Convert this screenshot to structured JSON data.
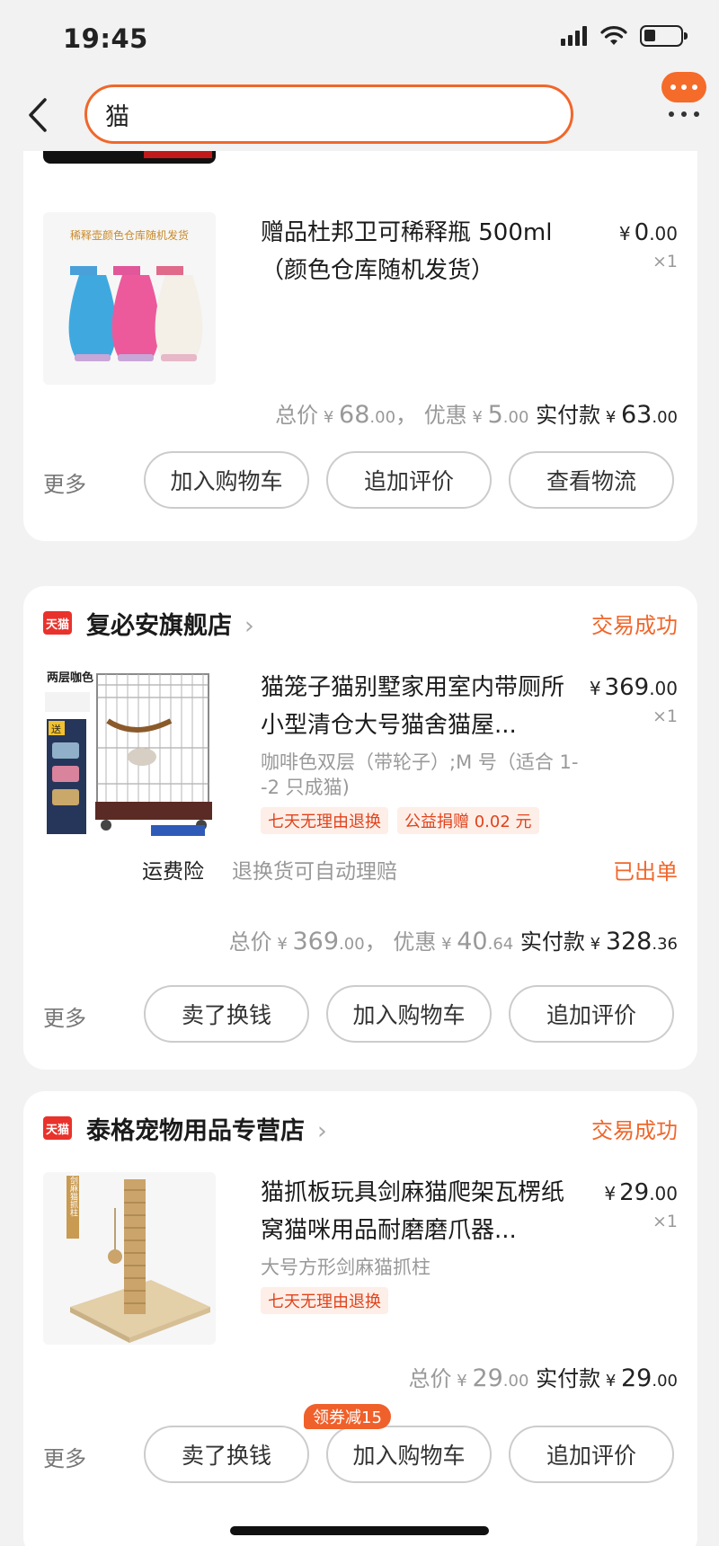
{
  "status_bar": {
    "time": "19:45"
  },
  "search": {
    "query": "猫"
  },
  "order1": {
    "product": {
      "title": "赠品杜邦卫可稀释瓶 500ml（颜色仓库随机发货）",
      "image_text": "稀释壶颜色仓库随机发货",
      "price_cur": "¥",
      "price_int": "0",
      "price_dec": ".00",
      "qty": "×1"
    },
    "totals": {
      "total_label": "总价",
      "total_int": "68",
      "total_dec": ".00",
      "sep": "，",
      "discount_label": "优惠",
      "discount_int": "5",
      "discount_dec": ".00",
      "pay_label": "实付款",
      "pay_int": "63",
      "pay_dec": ".00",
      "cur": "¥"
    },
    "actions": {
      "more": "更多",
      "btn1": "加入购物车",
      "btn2": "追加评价",
      "btn3": "查看物流"
    }
  },
  "order2": {
    "store": {
      "logo": "天猫",
      "name": "复必安旗舰店",
      "chevron": "›",
      "status": "交易成功"
    },
    "product": {
      "title": "猫笼子猫别墅家用室内带厕所小型清仓大号猫舍猫屋...",
      "image_text": "两层咖色",
      "image_badge": "送",
      "sku": "咖啡色双层（带轮子）;M 号（适合 1--2 只成猫)",
      "price_cur": "¥",
      "price_int": "369",
      "price_dec": ".00",
      "qty": "×1",
      "tags": [
        "七天无理由退换",
        "公益捐赠 0.02 元"
      ]
    },
    "insurance": {
      "label": "运费险",
      "desc": "退换货可自动理赔",
      "status": "已出单"
    },
    "totals": {
      "total_label": "总价",
      "total_int": "369",
      "total_dec": ".00",
      "sep": "，",
      "discount_label": "优惠",
      "discount_int": "40",
      "discount_dec": ".64",
      "pay_label": "实付款",
      "pay_int": "328",
      "pay_dec": ".36",
      "cur": "¥"
    },
    "actions": {
      "more": "更多",
      "btn1": "卖了换钱",
      "btn2": "加入购物车",
      "btn3": "追加评价"
    }
  },
  "order3": {
    "store": {
      "logo": "天猫",
      "name": "泰格宠物用品专营店",
      "chevron": "›",
      "status": "交易成功"
    },
    "product": {
      "title": "猫抓板玩具剑麻猫爬架瓦楞纸窝猫咪用品耐磨磨爪器...",
      "image_text": "方形剑麻猫抓柱",
      "sku": "大号方形剑麻猫抓柱",
      "price_cur": "¥",
      "price_int": "29",
      "price_dec": ".00",
      "qty": "×1",
      "tags": [
        "七天无理由退换"
      ]
    },
    "totals": {
      "total_label": "总价",
      "total_int": "29",
      "total_dec": ".00",
      "pay_label": "实付款",
      "pay_int": "29",
      "pay_dec": ".00",
      "cur": "¥"
    },
    "coupon": "领券减15",
    "actions": {
      "more": "更多",
      "btn1": "卖了换钱",
      "btn2": "加入购物车",
      "btn3": "追加评价"
    }
  },
  "colors": {
    "accent": "#f0672b",
    "tmall_red": "#e9322b",
    "muted": "#999999"
  }
}
